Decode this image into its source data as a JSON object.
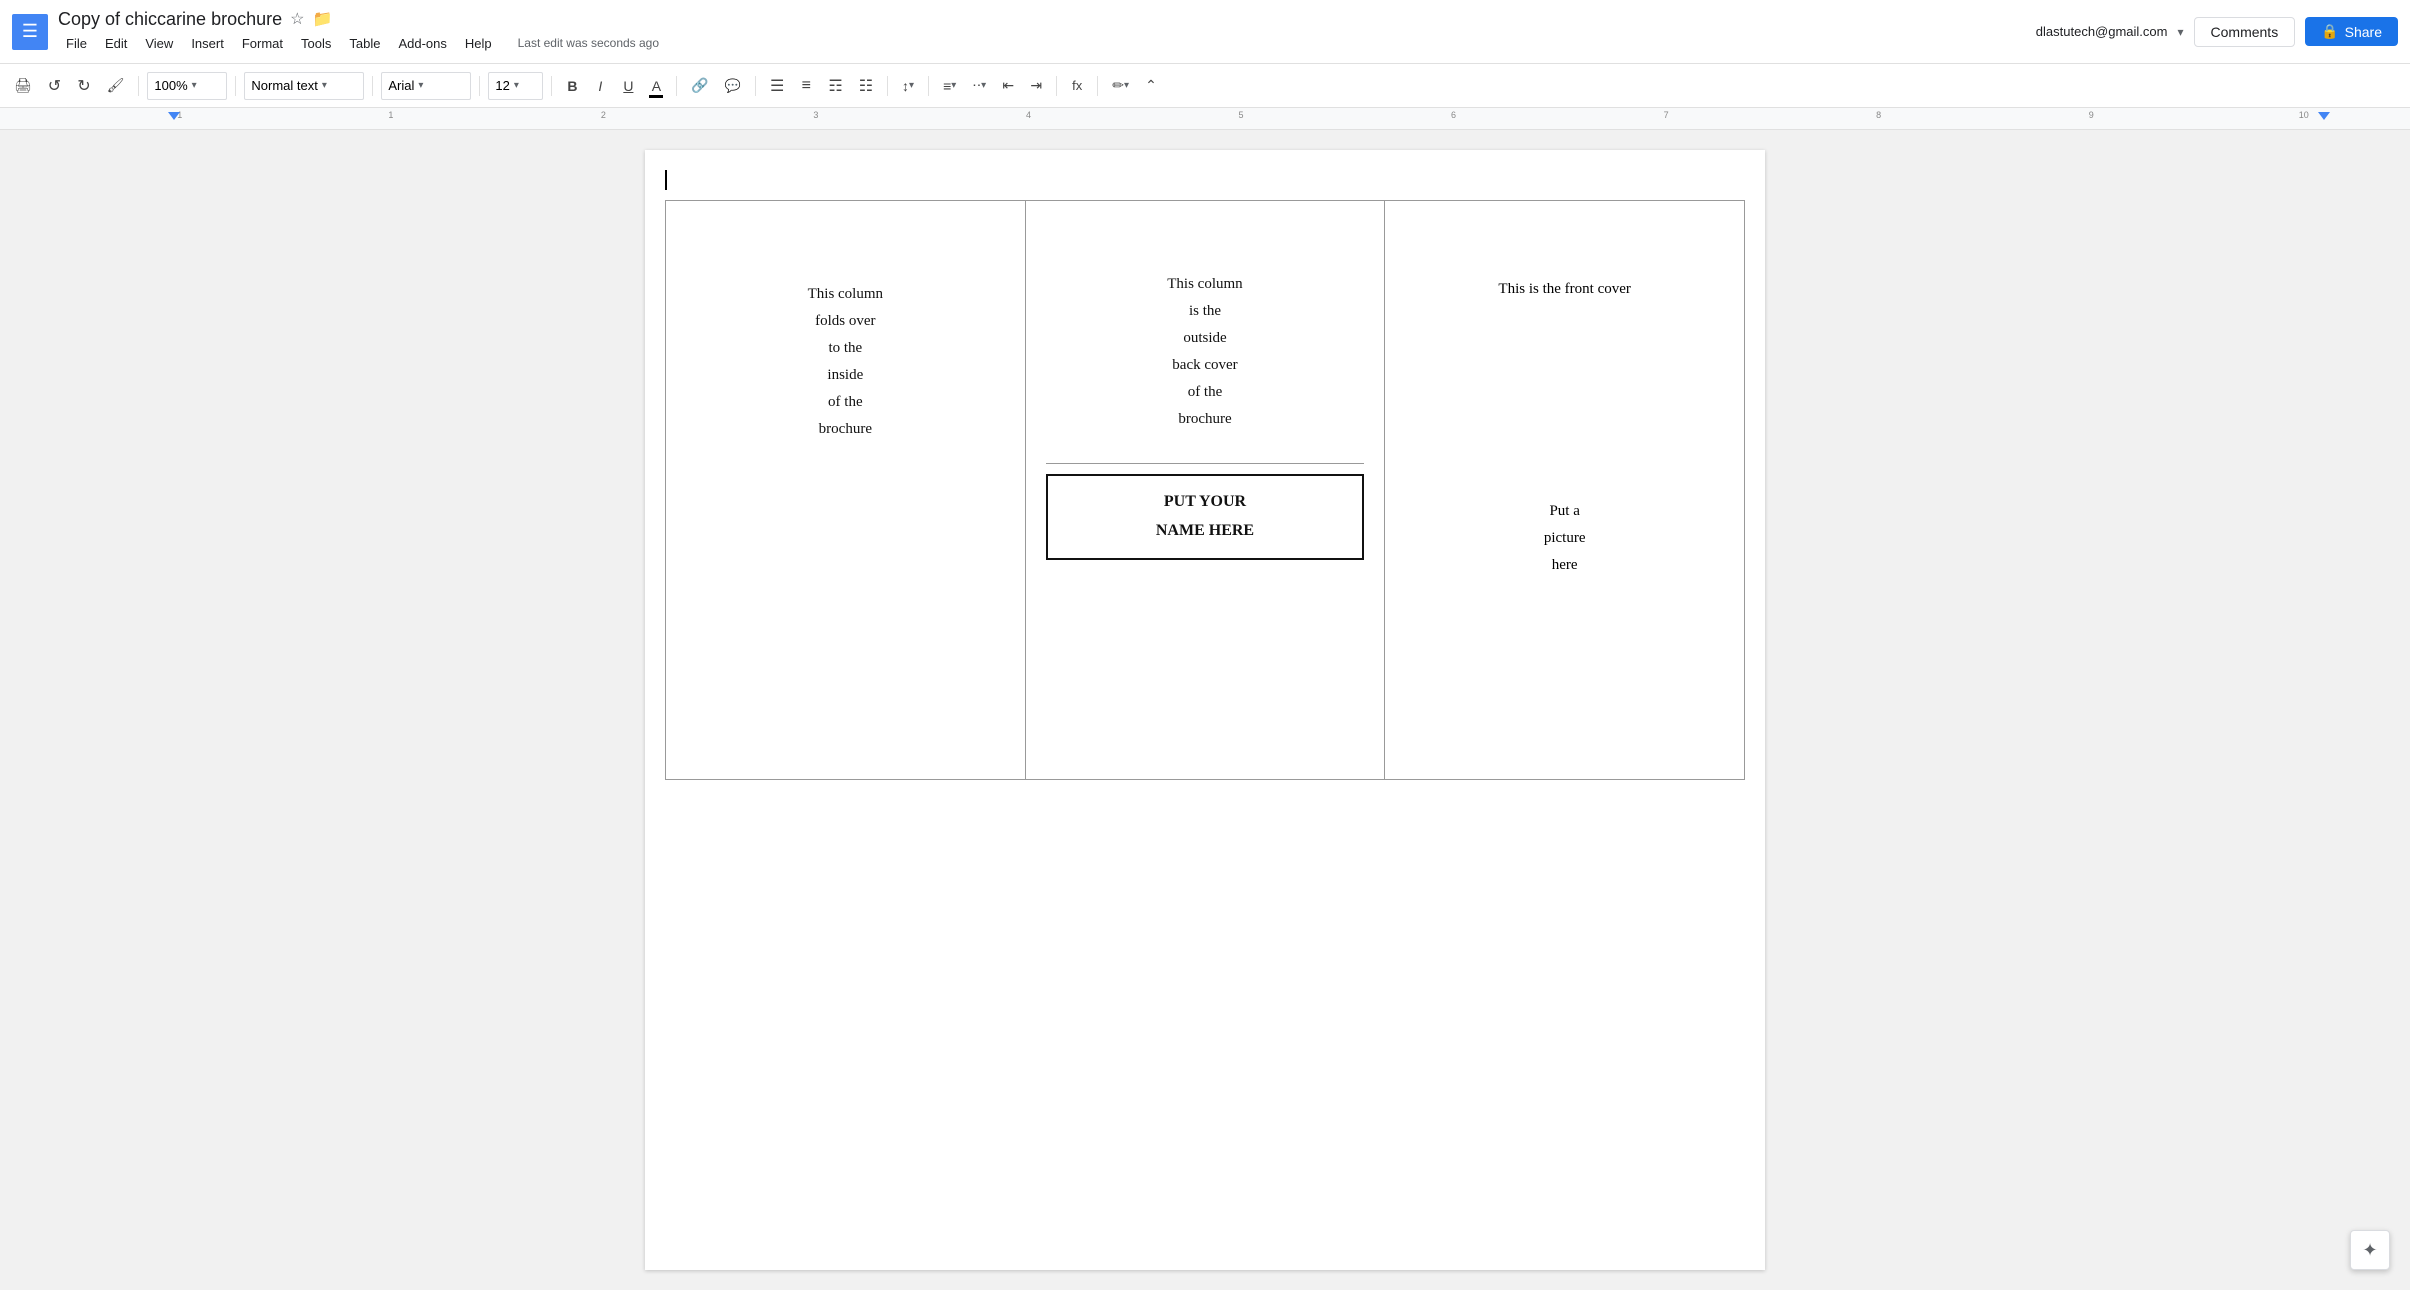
{
  "app": {
    "menu_icon": "☰",
    "title": "Copy of chiccarine brochure",
    "star_icon": "☆",
    "folder_icon": "📁"
  },
  "menu": {
    "items": [
      "File",
      "Edit",
      "View",
      "Insert",
      "Format",
      "Tools",
      "Table",
      "Add-ons",
      "Help"
    ]
  },
  "status": {
    "last_edit": "Last edit was seconds ago"
  },
  "top_right": {
    "user_email": "dlastutech@gmail.com",
    "dropdown_icon": "▾",
    "comments_label": "Comments",
    "share_label": "Share",
    "lock_icon": "🔒"
  },
  "toolbar": {
    "print_icon": "🖨",
    "undo_icon": "↺",
    "redo_icon": "↻",
    "paint_format_icon": "🖌",
    "zoom_value": "100%",
    "zoom_arrow": "▾",
    "style_value": "Normal text",
    "style_arrow": "▾",
    "font_value": "Arial",
    "font_arrow": "▾",
    "font_size_value": "12",
    "font_size_arrow": "▾",
    "bold_label": "B",
    "italic_label": "I",
    "underline_label": "U",
    "text_color_label": "A",
    "link_icon": "🔗",
    "comment_icon": "💬",
    "align_left": "≡",
    "align_center": "≡",
    "align_right": "≡",
    "align_justify": "≡",
    "line_spacing": "↕",
    "numbered_list": "≡",
    "bullet_list": "≡",
    "indent_decrease": "⇤",
    "indent_increase": "⇥",
    "formula_icon": "fx",
    "pen_icon": "✏",
    "collapse_icon": "⌃"
  },
  "ruler": {
    "marks": [
      "-1",
      "1",
      "2",
      "3",
      "4",
      "5",
      "6",
      "7",
      "8",
      "9",
      "10"
    ]
  },
  "document": {
    "col1": {
      "text": "This column folds over to the inside of the brochure"
    },
    "col2": {
      "top_text": "This column is the outside back cover of the brochure",
      "name_box_line1": "PUT YOUR",
      "name_box_line2": "NAME HERE"
    },
    "col3": {
      "top_text": "This is the front cover",
      "bottom_text": "Put a picture here"
    }
  },
  "assistant": {
    "icon": "✦"
  }
}
